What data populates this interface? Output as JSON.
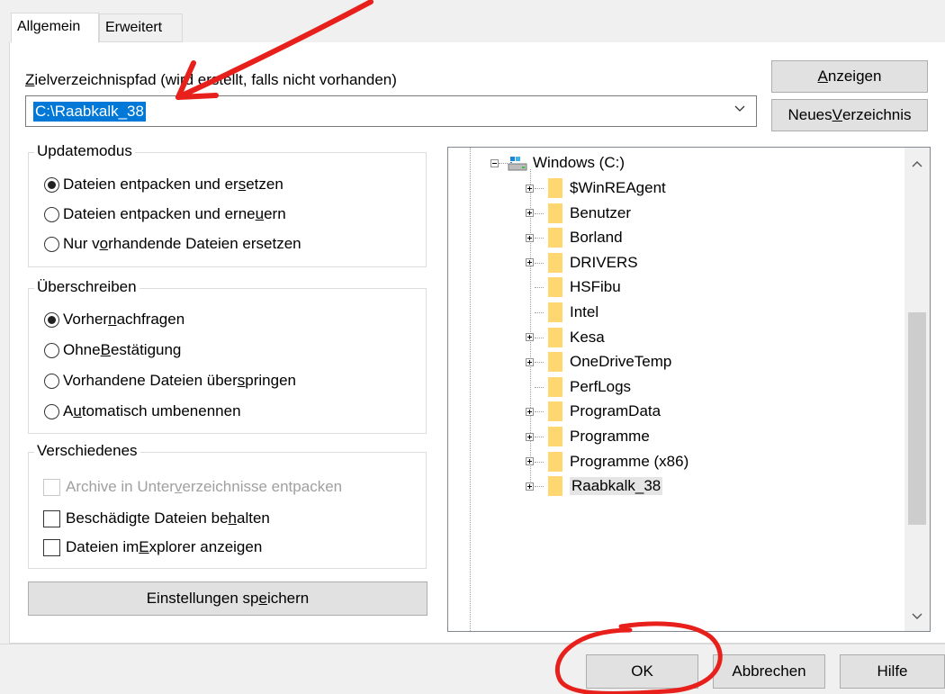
{
  "tabs": [
    {
      "label": "Allgemein",
      "active": true
    },
    {
      "label": "Erweitert",
      "active": false
    }
  ],
  "path": {
    "label_pre": "",
    "label_mnemonic": "Z",
    "label_post": "ielverzeichnispfad (wird erstellt, falls nicht vorhanden)",
    "value": "C:\\Raabkalk_38"
  },
  "buttons": {
    "show": {
      "mnemonic": "A",
      "rest": "nzeigen"
    },
    "new_dir": {
      "pre": "Neues ",
      "mnemonic": "V",
      "rest": "erzeichnis"
    },
    "save_settings": {
      "pre": "Einstellungen sp",
      "mnemonic": "e",
      "rest": "ichern"
    },
    "ok": "OK",
    "cancel": "Abbrechen",
    "help": "Hilfe"
  },
  "update_mode": {
    "title": "Updatemodus",
    "options": [
      {
        "pre": "Dateien entpacken und er",
        "mnemonic": "s",
        "post": "etzen",
        "selected": true
      },
      {
        "pre": "Dateien entpacken und erne",
        "mnemonic": "u",
        "post": "ern",
        "selected": false
      },
      {
        "pre": "Nur v",
        "mnemonic": "o",
        "post": "rhandende Dateien ersetzen",
        "selected": false
      }
    ]
  },
  "overwrite": {
    "title": "Überschreiben",
    "options": [
      {
        "pre": "Vorher ",
        "mnemonic": "n",
        "post": "achfragen",
        "selected": true
      },
      {
        "pre": "Ohne ",
        "mnemonic": "B",
        "post": "estätigung",
        "selected": false
      },
      {
        "pre": "Vorhandene Dateien über",
        "mnemonic": "s",
        "post": "pringen",
        "selected": false
      },
      {
        "pre": "A",
        "mnemonic": "u",
        "post": "tomatisch umbenennen",
        "selected": false
      }
    ]
  },
  "misc": {
    "title": "Verschiedenes",
    "options": [
      {
        "pre": "Archive in Unter",
        "mnemonic": "v",
        "post": "erzeichnisse entpacken",
        "checked": false,
        "disabled": true
      },
      {
        "pre": "Beschädigte Dateien be",
        "mnemonic": "h",
        "post": "alten",
        "checked": false,
        "disabled": false
      },
      {
        "pre": "Dateien im ",
        "mnemonic": "E",
        "post": "xplorer anzeigen",
        "checked": false,
        "disabled": false
      }
    ]
  },
  "tree": {
    "root": "Windows (C:)",
    "items": [
      {
        "label": "$WinREAgent",
        "expandable": true
      },
      {
        "label": "Benutzer",
        "expandable": true
      },
      {
        "label": "Borland",
        "expandable": true
      },
      {
        "label": "DRIVERS",
        "expandable": true
      },
      {
        "label": "HSFibu",
        "expandable": false
      },
      {
        "label": "Intel",
        "expandable": false
      },
      {
        "label": "Kesa",
        "expandable": true
      },
      {
        "label": "OneDriveTemp",
        "expandable": true
      },
      {
        "label": "PerfLogs",
        "expandable": false
      },
      {
        "label": "ProgramData",
        "expandable": true
      },
      {
        "label": "Programme",
        "expandable": true
      },
      {
        "label": "Programme (x86)",
        "expandable": true
      },
      {
        "label": "Raabkalk_38",
        "expandable": true,
        "selected": true
      }
    ]
  },
  "colors": {
    "annotation": "#e8201c",
    "selection": "#0078d7",
    "tree_selection": "#e5e5e5"
  },
  "icons": [
    "drive-icon",
    "folder-icon",
    "chevron-down-icon",
    "chevron-up-icon",
    "annotation-arrow-icon",
    "annotation-circle-icon"
  ]
}
